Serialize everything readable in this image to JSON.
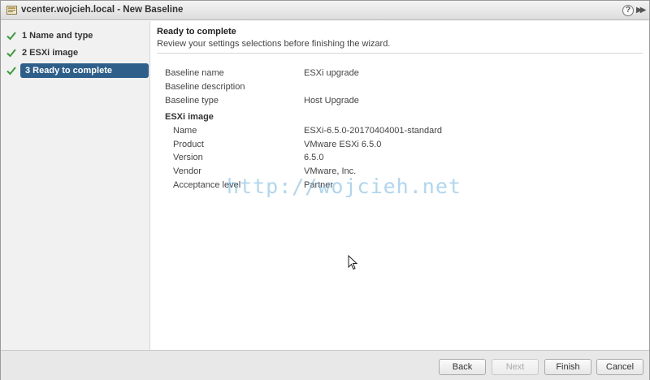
{
  "window": {
    "title": "vcenter.wojcieh.local - New Baseline",
    "help_label": "?",
    "expand_label": "▶▶"
  },
  "sidebar": {
    "steps": [
      {
        "label": "1  Name and type",
        "completed": true,
        "active": false
      },
      {
        "label": "2  ESXi image",
        "completed": true,
        "active": false
      },
      {
        "label": "3  Ready to complete",
        "completed": true,
        "active": true
      }
    ]
  },
  "main": {
    "title": "Ready to complete",
    "subtitle": "Review your settings selections before finishing the wizard.",
    "summary": [
      {
        "label": "Baseline name",
        "value": "ESXi upgrade"
      },
      {
        "label": "Baseline description",
        "value": ""
      },
      {
        "label": "Baseline type",
        "value": "Host Upgrade"
      }
    ],
    "esxi_section": {
      "heading": "ESXi image",
      "rows": [
        {
          "label": "Name",
          "value": "ESXi-6.5.0-20170404001-standard"
        },
        {
          "label": "Product",
          "value": "VMware ESXi 6.5.0"
        },
        {
          "label": "Version",
          "value": "6.5.0"
        },
        {
          "label": "Vendor",
          "value": "VMware, Inc."
        },
        {
          "label": "Acceptance level",
          "value": "Partner"
        }
      ]
    }
  },
  "watermark": "http://wojcieh.net",
  "footer": {
    "back_label": "Back",
    "next_label": "Next",
    "finish_label": "Finish",
    "cancel_label": "Cancel"
  },
  "colors": {
    "check_green": "#3c9a3c",
    "active_step_bg": "#2e5f8a",
    "sidebar_bg": "#f1f1f1",
    "footer_bg": "#e8e8e8"
  }
}
